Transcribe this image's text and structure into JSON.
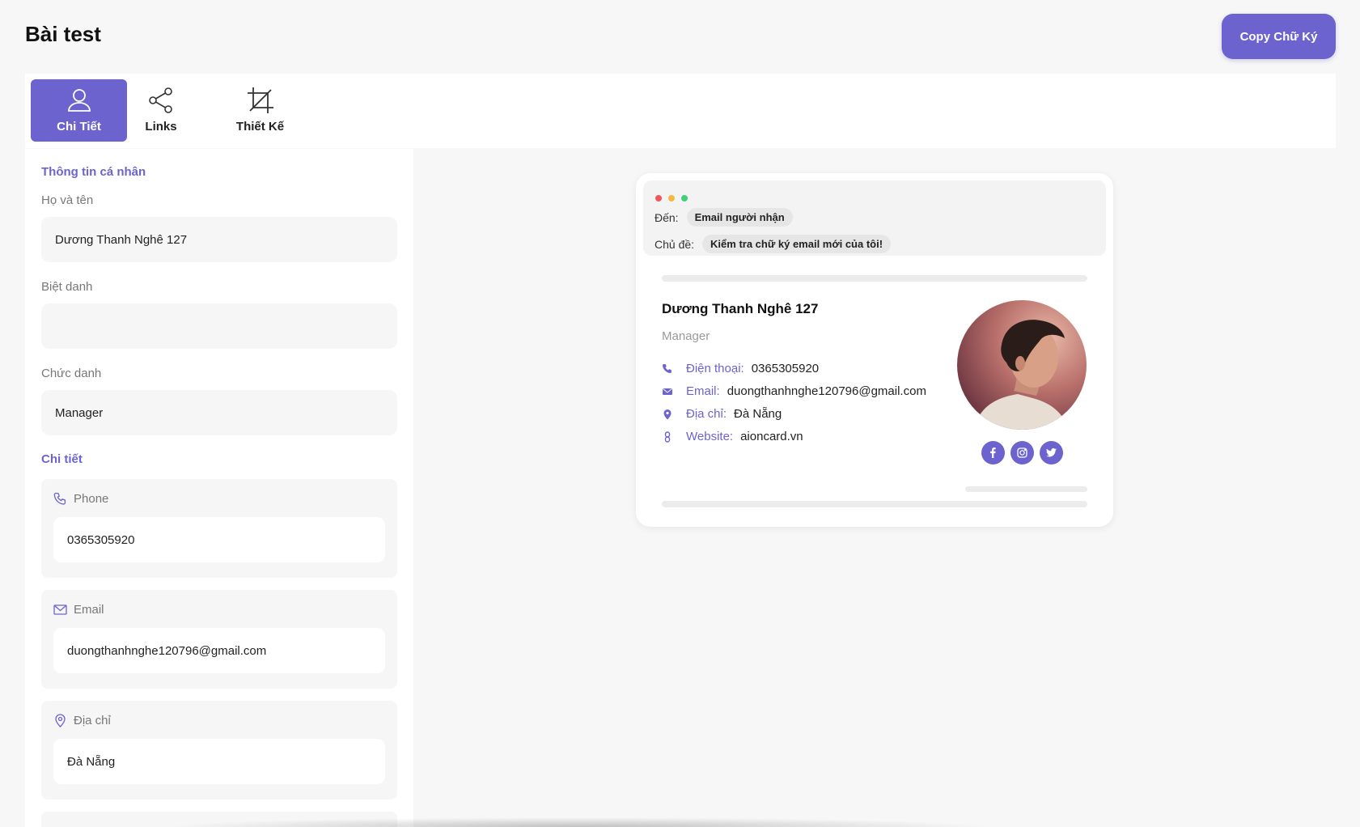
{
  "header": {
    "title": "Bài test",
    "copy_button": "Copy Chữ Ký"
  },
  "tabs": [
    {
      "label": "Chi Tiết",
      "icon": "user-icon",
      "active": true
    },
    {
      "label": "Links",
      "icon": "share-icon",
      "active": false
    },
    {
      "label": "Thiết Kế",
      "icon": "crop-icon",
      "active": false
    }
  ],
  "form": {
    "personal_section": "Thông tin cá nhân",
    "full_name_label": "Họ và tên",
    "full_name_value": "Dương Thanh Nghê 127",
    "nickname_label": "Biệt danh",
    "nickname_value": "",
    "title_label": "Chức danh",
    "title_value": "Manager",
    "details_section": "Chi tiết",
    "phone_label": "Phone",
    "phone_value": "0365305920",
    "email_label": "Email",
    "email_value": "duongthanhnghe120796@gmail.com",
    "address_label": "Địa chỉ",
    "address_value": "Đà Nẵng"
  },
  "preview": {
    "to_label": "Đến:",
    "to_value": "Email người nhận",
    "subject_label": "Chủ đề:",
    "subject_value": "Kiểm tra chữ ký email mới của tôi!",
    "name": "Dương Thanh Nghê 127",
    "role": "Manager",
    "phone_key": "Điện thoại:",
    "phone_val": "0365305920",
    "email_key": "Email:",
    "email_val": "duongthanhnghe120796@gmail.com",
    "address_key": "Địa chỉ:",
    "address_val": "Đà Nẵng",
    "website_key": "Website:",
    "website_val": "aioncard.vn",
    "socials": [
      "facebook-icon",
      "instagram-icon",
      "twitter-icon"
    ]
  },
  "colors": {
    "accent": "#6c63cf",
    "background": "#f7f7f7",
    "dot_red": "#f2555a",
    "dot_yellow": "#f5b840",
    "dot_green": "#3fd07c"
  }
}
